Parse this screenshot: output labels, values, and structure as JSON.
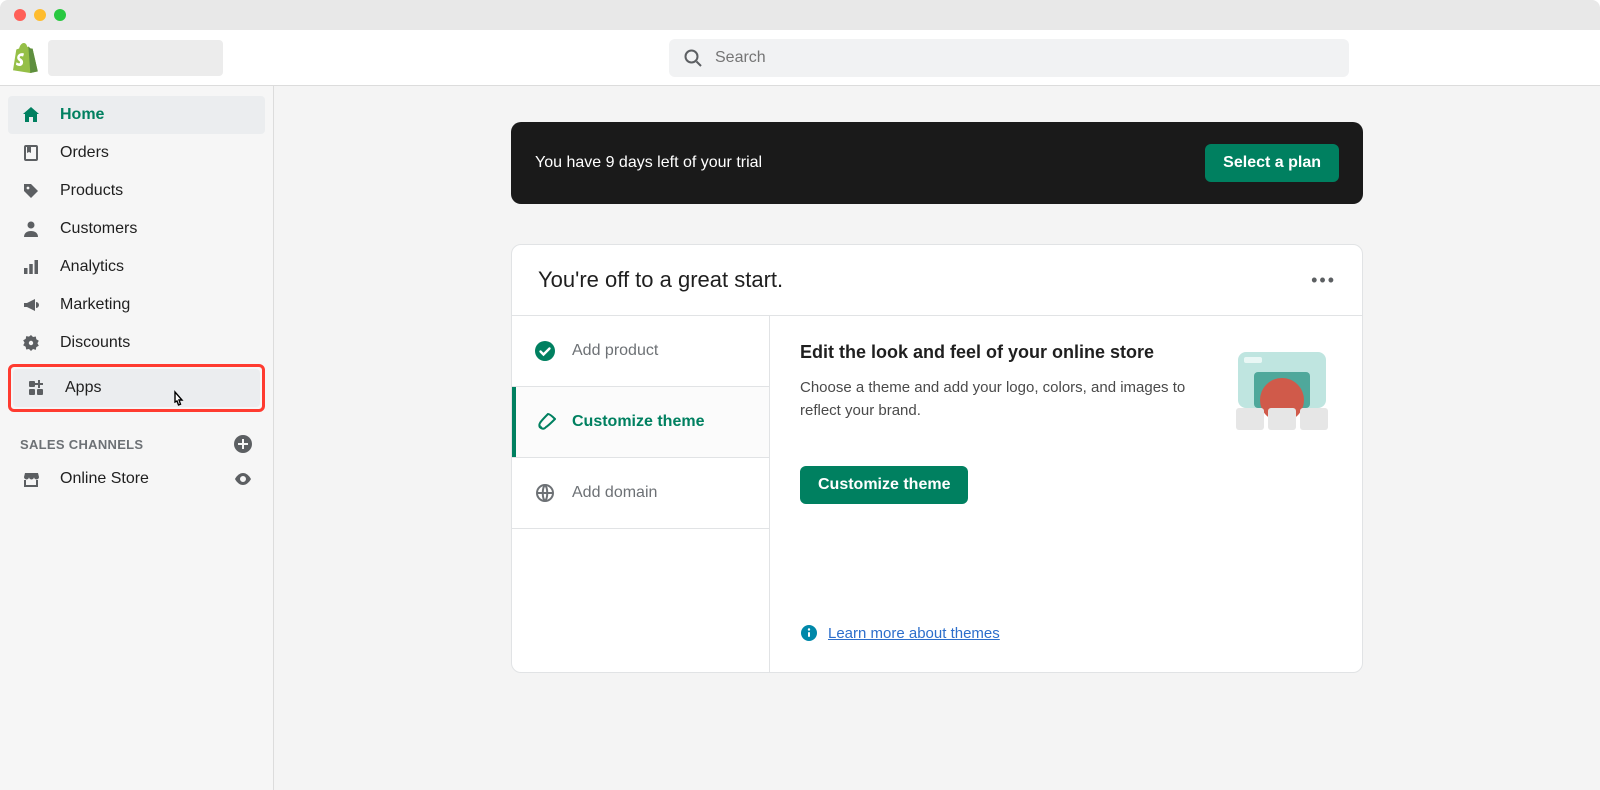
{
  "search": {
    "placeholder": "Search"
  },
  "sidebar": {
    "items": [
      {
        "label": "Home",
        "icon": "home-icon",
        "active": true
      },
      {
        "label": "Orders",
        "icon": "orders-icon"
      },
      {
        "label": "Products",
        "icon": "products-icon"
      },
      {
        "label": "Customers",
        "icon": "customers-icon"
      },
      {
        "label": "Analytics",
        "icon": "analytics-icon"
      },
      {
        "label": "Marketing",
        "icon": "marketing-icon"
      },
      {
        "label": "Discounts",
        "icon": "discounts-icon"
      },
      {
        "label": "Apps",
        "icon": "apps-icon",
        "highlighted": true
      }
    ],
    "section_label": "SALES CHANNELS",
    "channels": [
      {
        "label": "Online Store",
        "icon": "store-icon"
      }
    ]
  },
  "banner": {
    "text": "You have 9 days left of your trial",
    "button": "Select a plan"
  },
  "card": {
    "title": "You're off to a great start.",
    "steps": [
      {
        "label": "Add product",
        "icon": "check-icon",
        "state": "done"
      },
      {
        "label": "Customize theme",
        "icon": "brush-icon",
        "state": "active"
      },
      {
        "label": "Add domain",
        "icon": "globe-icon",
        "state": "pending"
      }
    ],
    "detail": {
      "heading": "Edit the look and feel of your online store",
      "body": "Choose a theme and add your logo, colors, and images to reflect your brand.",
      "button": "Customize theme",
      "learn_link": "Learn more about themes"
    }
  }
}
